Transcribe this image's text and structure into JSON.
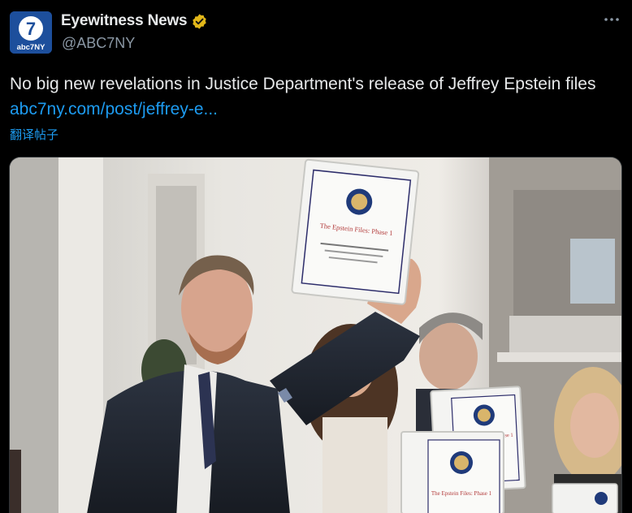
{
  "account": {
    "display_name": "Eyewitness News",
    "handle": "@ABC7NY",
    "avatar_text": "abc7NY",
    "avatar_number": "7",
    "verified": true
  },
  "tweet": {
    "text": "No big new revelations in Justice Department's release of Jeffrey Epstein files",
    "link_text": "abc7ny.com/post/jeffrey-e...",
    "translate_label": "翻译帖子"
  },
  "media": {
    "binder_main_title": "The Epstein Files: Phase 1",
    "binder_right_title": "The Epstein Files: Phase 1",
    "binder_bottom_title": "The Epstein Files: Phase 1"
  },
  "icons": {
    "more": "more-options-icon",
    "verified": "verified-badge-icon"
  },
  "colors": {
    "background": "#000000",
    "text": "#e7e9ea",
    "secondary": "#8b98a5",
    "link": "#1d9bf0",
    "verified_gold": "#e2b719",
    "avatar_blue": "#1d4f9c"
  }
}
